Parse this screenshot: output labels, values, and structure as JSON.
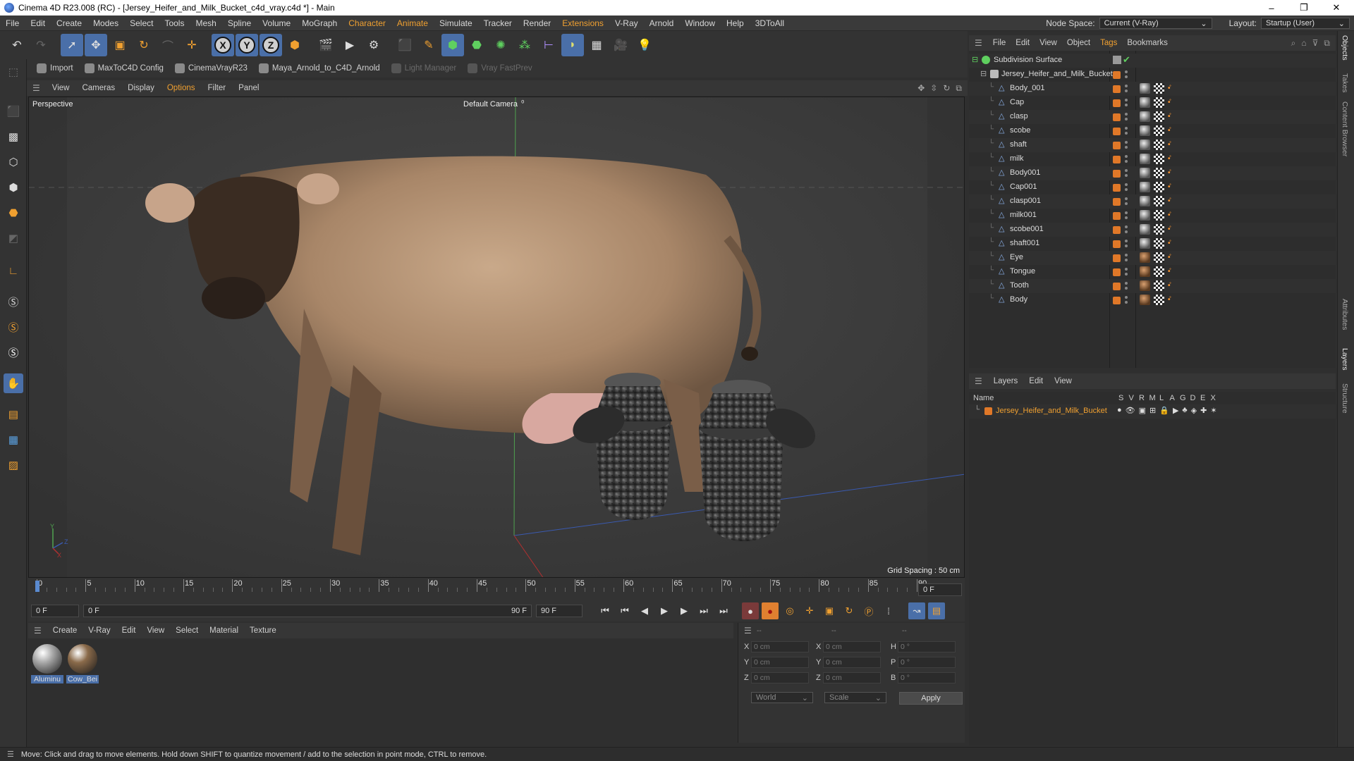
{
  "window": {
    "title": "Cinema 4D R23.008 (RC) - [Jersey_Heifer_and_Milk_Bucket_c4d_vray.c4d *] - Main",
    "minimize": "–",
    "maximize": "❐",
    "close": "✕"
  },
  "menubar": {
    "items": [
      "File",
      "Edit",
      "Create",
      "Modes",
      "Select",
      "Tools",
      "Mesh",
      "Spline",
      "Volume",
      "MoGraph",
      "Character",
      "Animate",
      "Simulate",
      "Tracker",
      "Render",
      "Extensions",
      "V-Ray",
      "Arnold",
      "Window",
      "Help",
      "3DToAll"
    ],
    "highlighted": [
      "Character",
      "Animate",
      "Extensions"
    ],
    "node_space_label": "Node Space:",
    "node_space_value": "Current (V-Ray)",
    "layout_label": "Layout:",
    "layout_value": "Startup (User)"
  },
  "plugins": [
    {
      "label": "Import",
      "enabled": true
    },
    {
      "label": "MaxToC4D Config",
      "enabled": true
    },
    {
      "label": "CinemaVrayR23",
      "enabled": true
    },
    {
      "label": "Maya_Arnold_to_C4D_Arnold",
      "enabled": true
    },
    {
      "label": "Light Manager",
      "enabled": false
    },
    {
      "label": "Vray FastPrev",
      "enabled": false
    }
  ],
  "viewport": {
    "menu": [
      "View",
      "Cameras",
      "Display",
      "Options",
      "Filter",
      "Panel"
    ],
    "menu_highlighted": "Options",
    "view_name": "Perspective",
    "camera_name": "Default Camera",
    "grid_spacing": "Grid Spacing : 50 cm",
    "axis_y": "Y",
    "axis_x": "X",
    "axis_z": "Z"
  },
  "timeline": {
    "ticks": [
      "0",
      "5",
      "10",
      "15",
      "20",
      "25",
      "30",
      "35",
      "40",
      "45",
      "50",
      "55",
      "60",
      "65",
      "70",
      "75",
      "80",
      "85",
      "90"
    ],
    "current_frame_right": "0 F",
    "start_field": "0 F",
    "preview_start": "0 F",
    "preview_end": "90 F",
    "end_field": "90 F"
  },
  "materials": {
    "menu": [
      "Create",
      "V-Ray",
      "Edit",
      "View",
      "Select",
      "Material",
      "Texture"
    ],
    "items": [
      {
        "label": "Aluminu",
        "color": "#a8a8a8"
      },
      {
        "label": "Cow_Bei",
        "color": "#8a6a4a"
      }
    ]
  },
  "coordinates": {
    "header": [
      "--",
      "--",
      "--"
    ],
    "rows": [
      {
        "a": "X",
        "av": "0 cm",
        "b": "X",
        "bv": "0 cm",
        "c": "H",
        "cv": "0 °"
      },
      {
        "a": "Y",
        "av": "0 cm",
        "b": "Y",
        "bv": "0 cm",
        "c": "P",
        "cv": "0 °"
      },
      {
        "a": "Z",
        "av": "0 cm",
        "b": "Z",
        "bv": "0 cm",
        "c": "B",
        "cv": "0 °"
      }
    ],
    "mode1": "World",
    "mode2": "Scale",
    "apply": "Apply"
  },
  "objects": {
    "menu": [
      "File",
      "Edit",
      "View",
      "Object",
      "Tags",
      "Bookmarks"
    ],
    "menu_highlighted": "Tags",
    "root": "Subdivision Surface",
    "group": "Jersey_Heifer_and_Milk_Bucket",
    "items": [
      {
        "name": "Body_001",
        "mat": "sph"
      },
      {
        "name": "Cap",
        "mat": "sph"
      },
      {
        "name": "clasp",
        "mat": "sph"
      },
      {
        "name": "scobe",
        "mat": "sph"
      },
      {
        "name": "shaft",
        "mat": "sph"
      },
      {
        "name": "milk",
        "mat": "sph"
      },
      {
        "name": "Body001",
        "mat": "sph"
      },
      {
        "name": "Cap001",
        "mat": "sph"
      },
      {
        "name": "clasp001",
        "mat": "sph"
      },
      {
        "name": "milk001",
        "mat": "sph"
      },
      {
        "name": "scobe001",
        "mat": "sph"
      },
      {
        "name": "shaft001",
        "mat": "sph"
      },
      {
        "name": "Eye",
        "mat": "sph2"
      },
      {
        "name": "Tongue",
        "mat": "sph2"
      },
      {
        "name": "Tooth",
        "mat": "sph2"
      },
      {
        "name": "Body",
        "mat": "sph2"
      }
    ]
  },
  "layers": {
    "menu": [
      "Layers",
      "Edit",
      "View"
    ],
    "columns": [
      "Name",
      "S",
      "V",
      "R",
      "M",
      "L",
      "A",
      "G",
      "D",
      "E",
      "X"
    ],
    "items": [
      {
        "name": "Jersey_Heifer_and_Milk_Bucket",
        "color": "#e07828"
      }
    ]
  },
  "side_tabs": [
    "Objects",
    "Takes",
    "Content Browser",
    "Attributes",
    "Layers",
    "Structure"
  ],
  "status": "Move: Click and drag to move elements. Hold down SHIFT to quantize movement / add to the selection in point mode, CTRL to remove.",
  "colors": {
    "accent": "#f0a030",
    "selection": "#4a6fa8",
    "layer": "#e07828"
  }
}
